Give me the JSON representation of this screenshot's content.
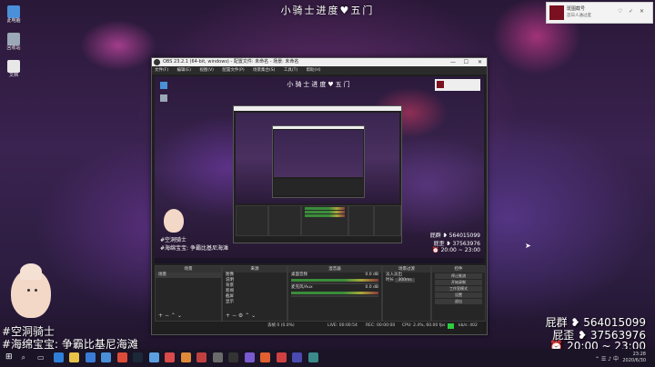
{
  "stream_title": "小骑士进度♥五门",
  "desktop_icons": [
    {
      "label": "此电脑",
      "icon": "computer-icon",
      "color": "#4a90d9"
    },
    {
      "label": "回收站",
      "icon": "recycle-bin-icon",
      "color": "#9aa8b8"
    },
    {
      "label": "文档",
      "icon": "document-icon",
      "color": "#e8e8e8"
    }
  ],
  "toast": {
    "title": "斑图截号",
    "subtitle": "首日人通过度"
  },
  "obs": {
    "title": "OBS 23.2.1 (64-bit, windows) - 配置文件: 未命名 - 场景: 未命名",
    "menu": [
      "文件(F)",
      "编辑(E)",
      "视图(V)",
      "配置文件(P)",
      "场景集合(S)",
      "工具(T)",
      "帮助(H)"
    ],
    "preview_title": "小骑士进度♥五门",
    "docks": {
      "scenes": {
        "header": "场景",
        "items": [
          "场景"
        ]
      },
      "sources": {
        "header": "来源",
        "items": [
          "图像",
          "说明",
          "背景",
          "新闻",
          "截屏",
          "显示"
        ]
      },
      "mixer": {
        "header": "混音器",
        "tracks": [
          {
            "name": "桌面音频",
            "level": "0.0 dB"
          },
          {
            "name": "麦克风/Aux",
            "level": "0.0 dB"
          }
        ]
      },
      "transitions": {
        "header": "场景过渡",
        "label1": "淡入淡出",
        "label2": "时长",
        "duration": "300ms"
      },
      "controls": {
        "header": "控件",
        "buttons": [
          "停止推流",
          "开始录制",
          "工作室模式",
          "设置",
          "退出"
        ]
      }
    },
    "status": {
      "dropped": "丢帧 0 (0.0%)",
      "live": "LIVE: 00:00:54",
      "rec": "REC: 00:00:00",
      "cpu": "CPU: 2.4%, 60.00 fps",
      "bitrate": "kb/s: 402"
    }
  },
  "overlay": {
    "name": "#空洞骑士",
    "line2": "#海绵宝宝: 争霸比基尼海滩",
    "fan_group_label": "屁群",
    "fan_group_num": "564015099",
    "fan_group2_label": "屁歪",
    "fan_group2_num": "37563976",
    "time_range": "20:00 ~ 23:00"
  },
  "taskbar": {
    "time": "23:28",
    "date": "2020/6/30",
    "apps": [
      {
        "icon": "start-icon",
        "color": "#ffffff"
      },
      {
        "icon": "search-icon",
        "color": "#dddddd"
      },
      {
        "icon": "task-view-icon",
        "color": "#dddddd"
      },
      {
        "icon": "edge-icon",
        "color": "#2f7fd8"
      },
      {
        "icon": "explorer-icon",
        "color": "#e8c34a"
      },
      {
        "icon": "store-icon",
        "color": "#3a7bd5"
      },
      {
        "icon": "mail-icon",
        "color": "#4a90d9"
      },
      {
        "icon": "chrome-icon",
        "color": "#dd4b39"
      },
      {
        "icon": "steam-icon",
        "color": "#1b2838"
      },
      {
        "icon": "app-icon",
        "color": "#5aa0e0"
      },
      {
        "icon": "app-icon",
        "color": "#d94a4a"
      },
      {
        "icon": "app-icon",
        "color": "#e08a3a"
      },
      {
        "icon": "app-icon",
        "color": "#c04040"
      },
      {
        "icon": "app-icon",
        "color": "#6a6a6a"
      },
      {
        "icon": "obs-icon",
        "color": "#333333"
      },
      {
        "icon": "app-icon",
        "color": "#7a5ad0"
      },
      {
        "icon": "app-icon",
        "color": "#e06030"
      },
      {
        "icon": "app-icon",
        "color": "#d04040"
      },
      {
        "icon": "app-icon",
        "color": "#4a4ab0"
      },
      {
        "icon": "app-icon",
        "color": "#3a8a8a"
      }
    ]
  }
}
